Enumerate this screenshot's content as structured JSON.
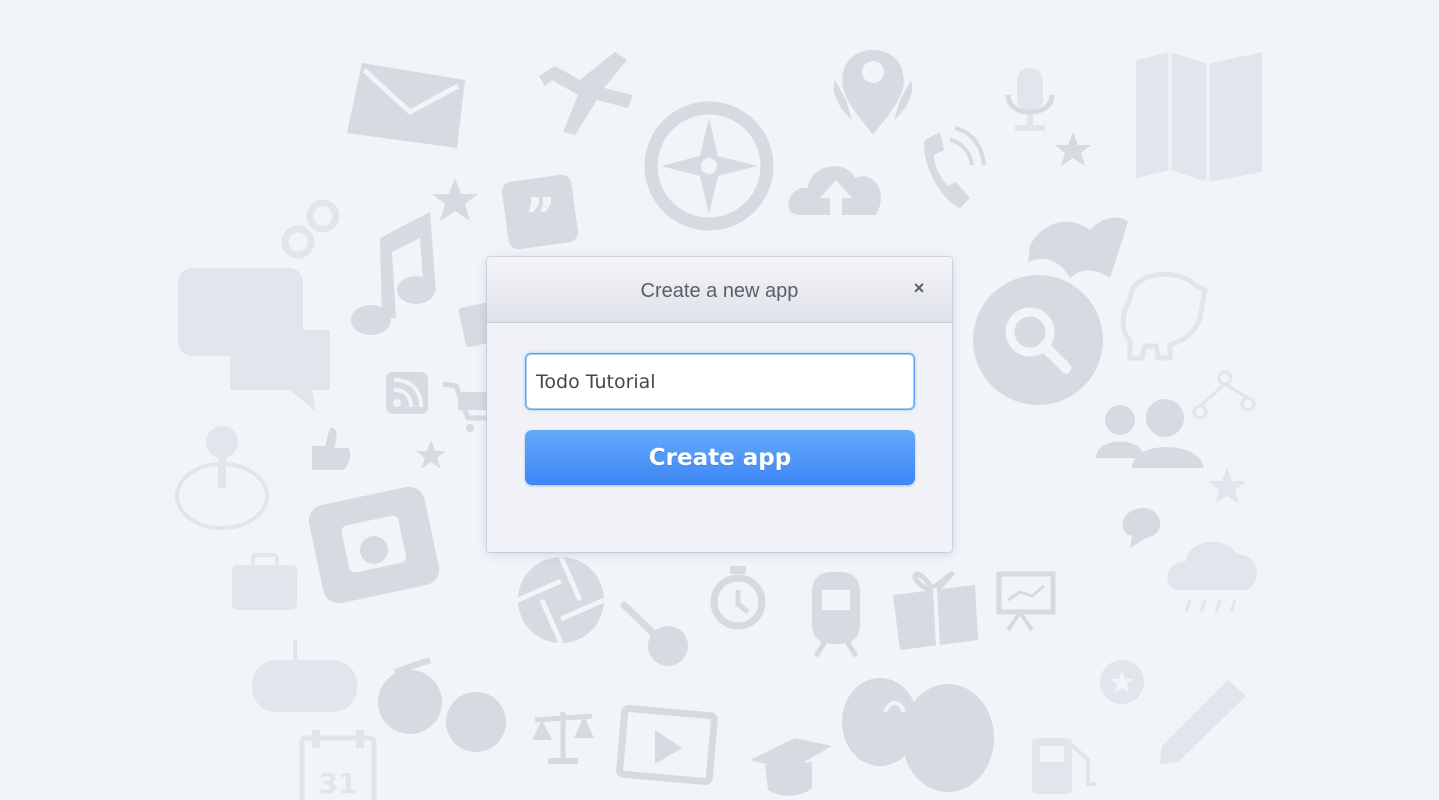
{
  "background": {
    "icons": [
      "envelope-icon",
      "airplane-icon",
      "compass-icon",
      "map-pin-icon",
      "microphone-icon",
      "map-icon",
      "star-icon",
      "quote-icon",
      "cloud-upload-icon",
      "phone-icon",
      "book-icon",
      "link-icon",
      "music-note-icon",
      "chat-bubble-icon",
      "search-icon",
      "piggy-bank-icon",
      "rss-icon",
      "shopping-cart-icon",
      "users-icon",
      "thumbs-up-icon",
      "joystick-icon",
      "camera-icon",
      "briefcase-icon",
      "aperture-icon",
      "guitar-icon",
      "stopwatch-icon",
      "train-icon",
      "gift-icon",
      "presentation-icon",
      "rain-cloud-icon",
      "gamepad-icon",
      "glasses-icon",
      "scales-icon",
      "video-player-icon",
      "graduation-cap-icon",
      "balloons-icon",
      "calendar-icon",
      "gas-pump-icon",
      "pencil-icon"
    ],
    "calendar_day": "31"
  },
  "modal": {
    "title": "Create a new app",
    "close_label": "×",
    "app_name_value": "Todo Tutorial",
    "create_button_label": "Create app"
  }
}
